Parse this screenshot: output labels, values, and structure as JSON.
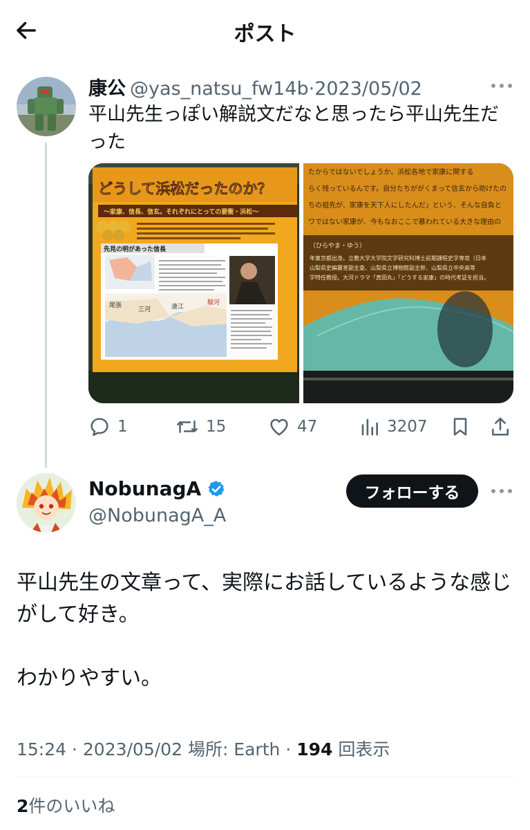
{
  "header": {
    "title": "ポスト"
  },
  "parent_tweet": {
    "display_name": "康公",
    "handle": "@yas_natsu_fw14b",
    "separator": "·",
    "date": "2023/05/02",
    "text": "平山先生っぽい解説文だなと思ったら平山先生だった",
    "media": {
      "left_panel": {
        "title": "どうして浜松だったのか？",
        "subtitle": "〜家康、信長、信玄。それぞれにとっての要衝・浜松〜",
        "section_label": "先見の明があった信長",
        "map_labels": [
          "三河",
          "遠江",
          "駿河",
          "尾張"
        ]
      },
      "right_panel": {
        "lines": [
          "たからではないでしょうか。浜松各地で家康に関する",
          "らく残っているんです。自分たちががくまって信玄から助けたの",
          "ちの祖先が、家康を天下人にしたんだ」という、そんな自負と",
          "ワではない家康が、今もなおここで慕われている大きな理由の"
        ],
        "profile_lines": [
          "（ひらやま・ゆう）",
          "年東京都出身。立教大学大学院文学研究科博士前期課程史学専攻（日本",
          "山梨県史編纂室副主査、山梨県立博物館副主幹、山梨県立中央高等",
          "学特任教授。大河ドラマ「真田丸」「どうする家康」の時代考証を担当。"
        ]
      }
    },
    "stats": {
      "replies": "1",
      "retweets": "15",
      "likes": "47",
      "views": "3207"
    }
  },
  "main_tweet": {
    "display_name": "NobunagA",
    "handle": "@NobunagA_A",
    "follow_label": "フォローする",
    "paragraphs": [
      "平山先生の文章って、実際にお話しているような感じがして好き。",
      "わかりやすい。"
    ],
    "time": "15:24",
    "date": "2023/05/02",
    "location_label": "場所: Earth",
    "views_count": "194",
    "views_label": "回表示",
    "likes_count": "2",
    "likes_label": "件のいいね"
  },
  "colors": {
    "text": "#0f1419",
    "secondary": "#536471",
    "verified": "#1d9bf0",
    "divider": "#eff3f4",
    "thread": "#cfd9de"
  },
  "icons": [
    "back-arrow-icon",
    "more-icon",
    "reply-icon",
    "retweet-icon",
    "like-icon",
    "views-icon",
    "bookmark-icon",
    "share-icon",
    "verified-badge-icon"
  ]
}
